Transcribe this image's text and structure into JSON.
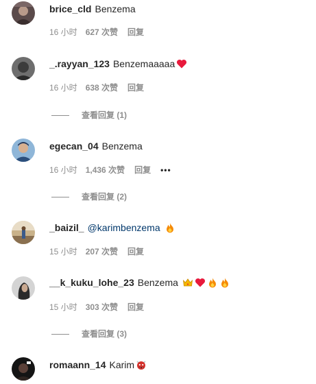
{
  "comments": [
    {
      "username": "brice_cld",
      "text": "Benzema",
      "time": "16 小时",
      "likes": "627 次赞",
      "reply": "回复"
    },
    {
      "username": "_.rayyan_123",
      "text": "Benzemaaaaa",
      "emojis": [
        "red-heart"
      ],
      "time": "16 小时",
      "likes": "638 次赞",
      "reply": "回复",
      "view_replies": "查看回复 (1)"
    },
    {
      "username": "egecan_04",
      "text": "Benzema",
      "time": "16 小时",
      "likes": "1,436 次赞",
      "reply": "回复",
      "more": "•••",
      "view_replies": "查看回复 (2)"
    },
    {
      "username": "_baizil_",
      "mention": "@karimbenzema",
      "emojis": [
        "fire"
      ],
      "time": "15 小时",
      "likes": "207 次赞",
      "reply": "回复"
    },
    {
      "username": "__k_kuku_lohe_23",
      "text": "Benzema",
      "emojis": [
        "crown",
        "red-heart",
        "fire",
        "fire"
      ],
      "time": "15 小时",
      "likes": "303 次赞",
      "reply": "回复",
      "view_replies": "查看回复 (3)"
    },
    {
      "username": "romaann_14",
      "text": "Karim",
      "emojis": [
        "ogre"
      ]
    }
  ],
  "colors": {
    "text": "#262626",
    "secondary": "#8e8e8e",
    "mention": "#00376b",
    "heart": "#e8193c",
    "fire": "#f58a07"
  }
}
